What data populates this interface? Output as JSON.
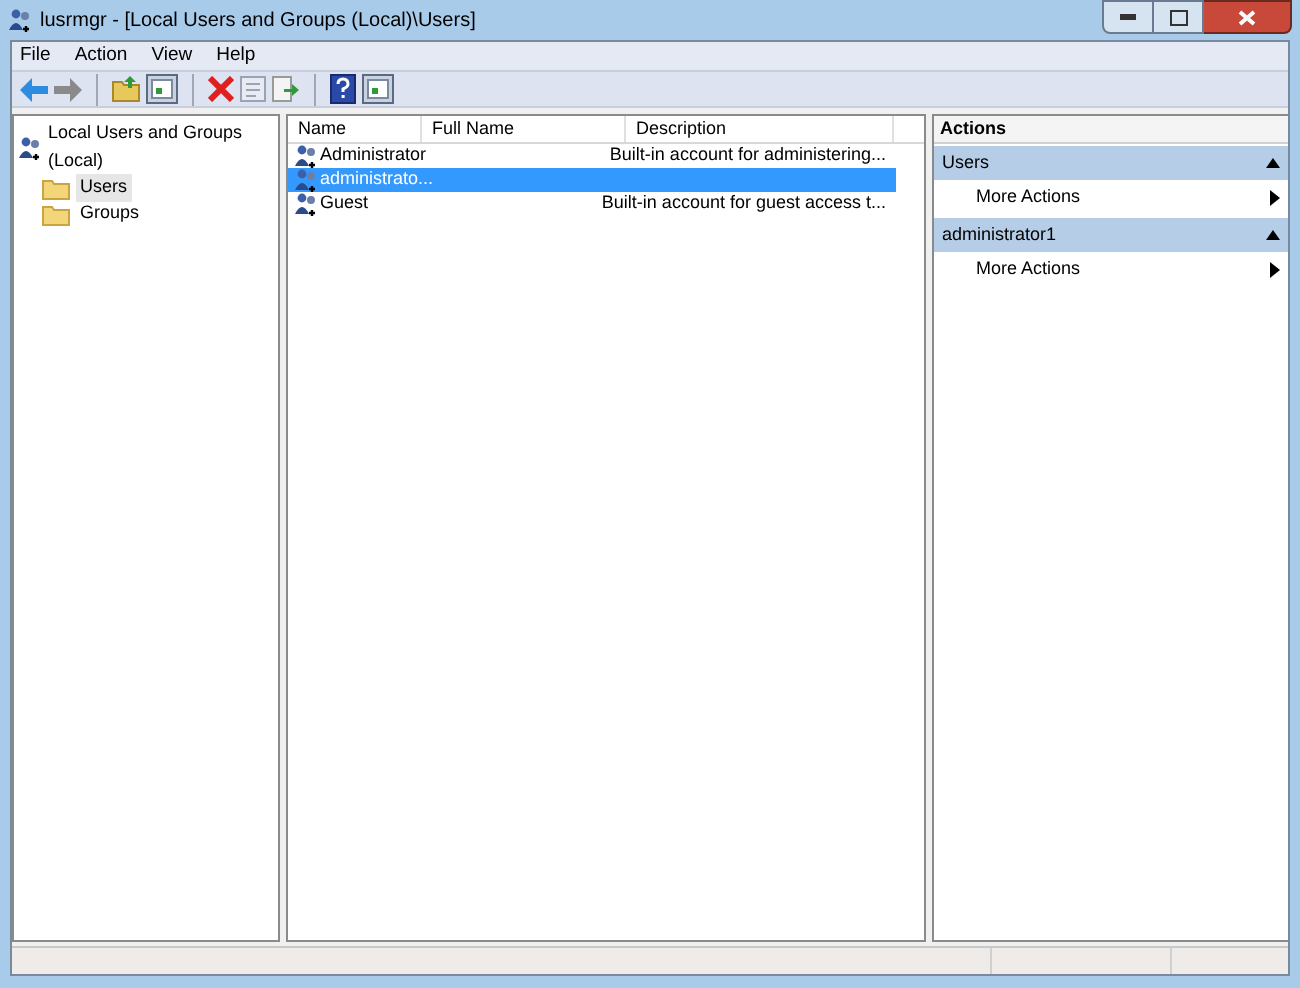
{
  "window": {
    "title": "lusrmgr - [Local Users and Groups (Local)\\Users]"
  },
  "menu": [
    "File",
    "Action",
    "View",
    "Help"
  ],
  "toolbar": [
    {
      "kind": "back"
    },
    {
      "kind": "forward"
    },
    {
      "kind": "sep"
    },
    {
      "kind": "up"
    },
    {
      "kind": "pane"
    },
    {
      "kind": "sep"
    },
    {
      "kind": "delete"
    },
    {
      "kind": "properties"
    },
    {
      "kind": "export"
    },
    {
      "kind": "sep"
    },
    {
      "kind": "help"
    },
    {
      "kind": "pane"
    }
  ],
  "tree": {
    "label": "Local Users and Groups (Local)",
    "children": [
      {
        "label": "Users",
        "selected": true
      },
      {
        "label": "Groups",
        "selected": false
      }
    ]
  },
  "table": {
    "columns": [
      "Name",
      "Full Name",
      "Description"
    ],
    "rows": [
      {
        "cells": [
          "Administrator",
          "",
          "Built-in account for administering..."
        ],
        "selected": false
      },
      {
        "cells": [
          "administrato...",
          "",
          ""
        ],
        "selected": true
      },
      {
        "cells": [
          "Guest",
          "",
          "Built-in account for guest access t..."
        ],
        "selected": false
      }
    ]
  },
  "actions": {
    "title": "Actions",
    "sections": [
      {
        "header": "Users",
        "items": [
          "More Actions"
        ]
      },
      {
        "header": "administrator1",
        "items": [
          "More Actions"
        ]
      }
    ]
  }
}
